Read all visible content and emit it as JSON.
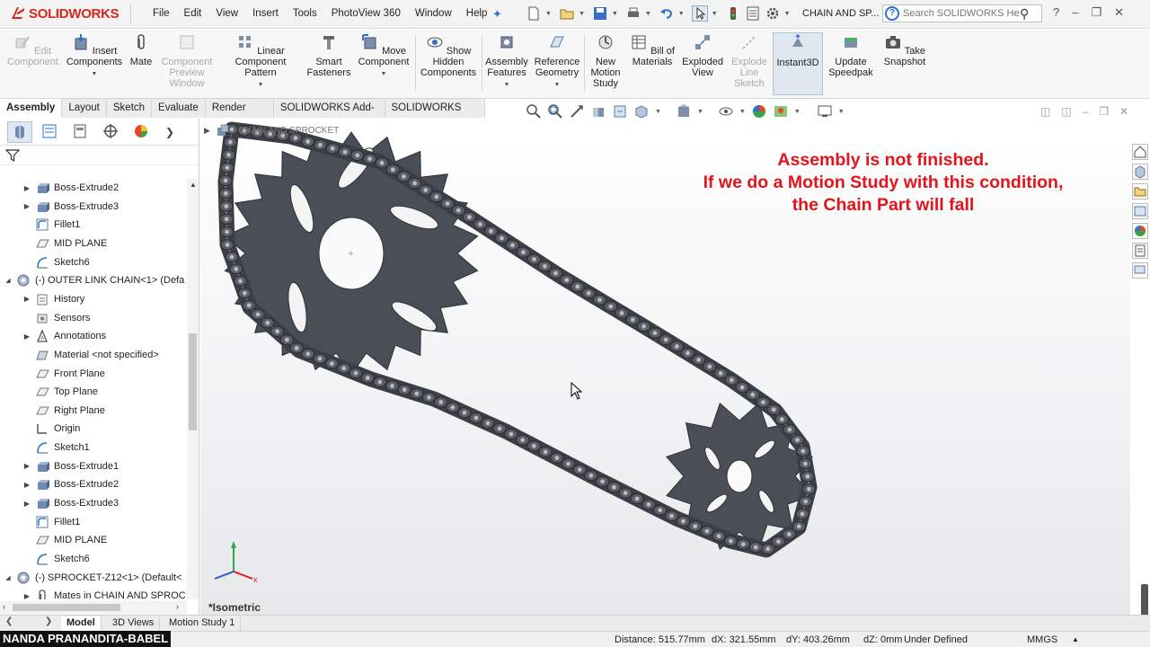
{
  "app": {
    "brand": "SOLIDWORKS",
    "menus": [
      "File",
      "Edit",
      "View",
      "Insert",
      "Tools",
      "PhotoView 360",
      "Window",
      "Help"
    ],
    "document_title": "CHAIN AND SP...",
    "search_placeholder": "Search SOLIDWORKS Help"
  },
  "command_manager": {
    "items": [
      {
        "label": "Edit Component",
        "enabled": false
      },
      {
        "label": "Insert Components",
        "enabled": true
      },
      {
        "label": "Mate",
        "enabled": true
      },
      {
        "label": "Component Preview Window",
        "enabled": false
      },
      {
        "label": "Linear Component Pattern",
        "enabled": true
      },
      {
        "label": "Smart Fasteners",
        "enabled": true
      },
      {
        "label": "Move Component",
        "enabled": true
      },
      {
        "label": "Show Hidden Components",
        "enabled": true
      },
      {
        "label": "Assembly Features",
        "enabled": true
      },
      {
        "label": "Reference Geometry",
        "enabled": true
      },
      {
        "label": "New Motion Study",
        "enabled": true
      },
      {
        "label": "Bill of Materials",
        "enabled": true
      },
      {
        "label": "Exploded View",
        "enabled": true
      },
      {
        "label": "Explode Line Sketch",
        "enabled": false
      },
      {
        "label": "Instant3D",
        "enabled": true,
        "active": true
      },
      {
        "label": "Update Speedpak",
        "enabled": true
      },
      {
        "label": "Take Snapshot",
        "enabled": true
      }
    ]
  },
  "tabs": {
    "items": [
      "Assembly",
      "Layout",
      "Sketch",
      "Evaluate",
      "Render Tools",
      "SOLIDWORKS Add-Ins",
      "SOLIDWORKS MBD"
    ],
    "active": "Assembly"
  },
  "feature_tree": {
    "items": [
      {
        "label": "Boss-Extrude2",
        "icon": "extrude-icon",
        "expandable": true,
        "indent": 1
      },
      {
        "label": "Boss-Extrude3",
        "icon": "extrude-icon",
        "expandable": true,
        "indent": 1
      },
      {
        "label": "Fillet1",
        "icon": "fillet-icon",
        "expandable": false,
        "indent": 1
      },
      {
        "label": "MID PLANE",
        "icon": "plane-icon",
        "expandable": false,
        "indent": 1
      },
      {
        "label": "Sketch6",
        "icon": "sketch-icon",
        "expandable": false,
        "indent": 1
      },
      {
        "label": "(-) OUTER LINK CHAIN<1> (Defa",
        "icon": "part-icon",
        "expandable": true,
        "expanded": true,
        "indent": 0
      },
      {
        "label": "History",
        "icon": "history-icon",
        "expandable": true,
        "indent": 1
      },
      {
        "label": "Sensors",
        "icon": "sensors-icon",
        "expandable": false,
        "indent": 1
      },
      {
        "label": "Annotations",
        "icon": "annotations-icon",
        "expandable": true,
        "indent": 1
      },
      {
        "label": "Material <not specified>",
        "icon": "material-icon",
        "expandable": false,
        "indent": 1
      },
      {
        "label": "Front Plane",
        "icon": "plane-icon",
        "expandable": false,
        "indent": 1
      },
      {
        "label": "Top Plane",
        "icon": "plane-icon",
        "expandable": false,
        "indent": 1
      },
      {
        "label": "Right Plane",
        "icon": "plane-icon",
        "expandable": false,
        "indent": 1
      },
      {
        "label": "Origin",
        "icon": "origin-icon",
        "expandable": false,
        "indent": 1
      },
      {
        "label": "Sketch1",
        "icon": "sketch-icon",
        "expandable": false,
        "indent": 1
      },
      {
        "label": "Boss-Extrude1",
        "icon": "extrude-icon",
        "expandable": true,
        "indent": 1
      },
      {
        "label": "Boss-Extrude2",
        "icon": "extrude-icon",
        "expandable": true,
        "indent": 1
      },
      {
        "label": "Boss-Extrude3",
        "icon": "extrude-icon",
        "expandable": true,
        "indent": 1
      },
      {
        "label": "Fillet1",
        "icon": "fillet-icon",
        "expandable": false,
        "indent": 1
      },
      {
        "label": "MID PLANE",
        "icon": "plane-icon",
        "expandable": false,
        "indent": 1
      },
      {
        "label": "Sketch6",
        "icon": "sketch-icon",
        "expandable": false,
        "indent": 1
      },
      {
        "label": "(-) SPROCKET-Z12<1> (Default<",
        "icon": "part-icon",
        "expandable": true,
        "expanded": true,
        "indent": 0
      },
      {
        "label": "Mates in CHAIN AND SPROC",
        "icon": "mates-icon",
        "expandable": true,
        "indent": 1
      }
    ]
  },
  "viewport": {
    "tree_title": "CHAIN AND SPROCKET",
    "annotation": [
      "Assembly is not finished.",
      "If we do a Motion Study with this condition,",
      "the Chain Part will fall"
    ],
    "annotation_color": "#e3141b",
    "view_orientation": "*Isometric"
  },
  "bottom_tabs": {
    "items": [
      "Model",
      "3D Views",
      "Motion Study 1"
    ],
    "active": "Model"
  },
  "status_bar": {
    "distance": "Distance: 515.77mm",
    "dx": "dX: 321.55mm",
    "dy": "dY: 403.26mm",
    "dz": "dZ: 0mm",
    "state": "Under Defined",
    "units": "MMGS"
  },
  "watermark": "NANDA PRANANDITA-BABEL"
}
